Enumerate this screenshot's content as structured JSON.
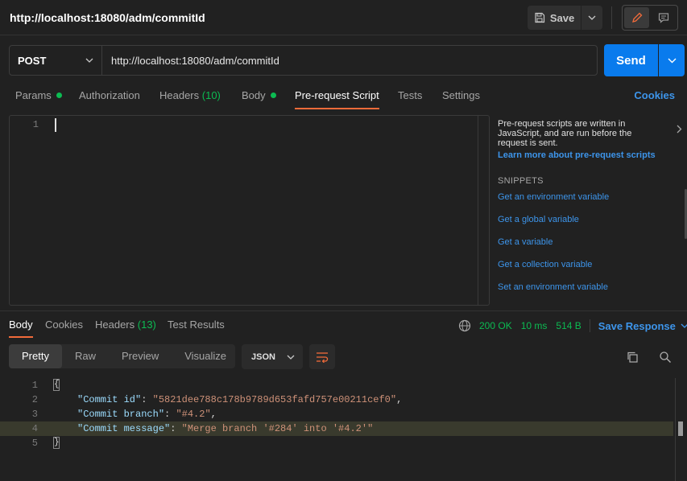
{
  "header": {
    "title": "http://localhost:18080/adm/commitId",
    "save_label": "Save",
    "icons": [
      "save-icon",
      "chevron-down-icon",
      "pencil-icon",
      "comment-icon"
    ]
  },
  "request": {
    "method": "POST",
    "url": "http://localhost:18080/adm/commitId",
    "send_label": "Send"
  },
  "request_tabs": {
    "params": "Params",
    "authorization": "Authorization",
    "headers": "Headers",
    "headers_count": "(10)",
    "body": "Body",
    "pre_request_script": "Pre-request Script",
    "tests": "Tests",
    "settings": "Settings",
    "cookies": "Cookies"
  },
  "editor": {
    "line_number": "1"
  },
  "side_panel": {
    "description": "Pre-request scripts are written in JavaScript, and are run before the request is sent.",
    "learn_more": "Learn more about pre-request scripts",
    "snippets_heading": "SNIPPETS",
    "snippets": [
      "Get an environment variable",
      "Get a global variable",
      "Get a variable",
      "Get a collection variable",
      "Set an environment variable"
    ]
  },
  "response_tabs": {
    "body": "Body",
    "cookies": "Cookies",
    "headers": "Headers",
    "headers_count": "(13)",
    "test_results": "Test Results"
  },
  "response_meta": {
    "status": "200 OK",
    "time": "10 ms",
    "size": "514 B",
    "save_response": "Save Response"
  },
  "view_modes": {
    "pretty": "Pretty",
    "raw": "Raw",
    "preview": "Preview",
    "visualize": "Visualize",
    "format": "JSON"
  },
  "response_body": {
    "line_numbers": [
      "1",
      "2",
      "3",
      "4",
      "5"
    ],
    "open_brace": "{",
    "close_brace": "}",
    "commit_id_key": "\"Commit id\"",
    "commit_id_value": "\"5821dee788c178b9789d653fafd757e00211cef0\"",
    "commit_branch_key": "\"Commit branch\"",
    "commit_branch_value": "\"#4.2\"",
    "commit_message_key": "\"Commit message\"",
    "commit_message_value": "\"Merge branch '#284' into '#4.2'\"",
    "colon": ": ",
    "comma": ","
  },
  "colors": {
    "accent_orange": "#f26b3a",
    "send_blue": "#097bed",
    "link_blue": "#3d95eb",
    "status_green": "#0cbb52"
  }
}
